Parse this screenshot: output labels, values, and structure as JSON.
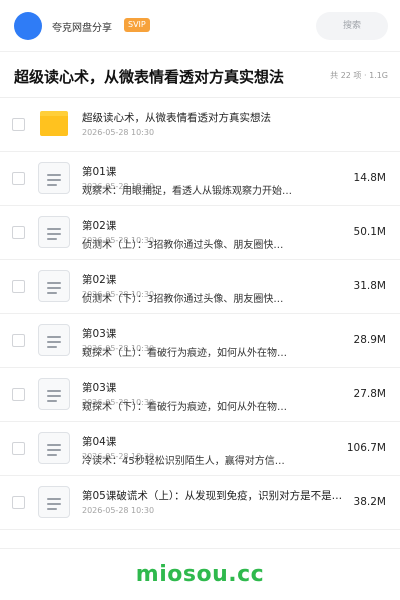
{
  "header": {
    "user_name": "夸克网盘分享",
    "badge": "SVIP",
    "search_placeholder": "搜索"
  },
  "share": {
    "title": "超级读心术，从微表情看透对方真实想法",
    "meta": "共 22 项 · 1.1G"
  },
  "folder": {
    "name": "超级读心术，从微表情看透对方真实想法",
    "date": "2026-05-28 10:30"
  },
  "files": [
    {
      "name": "第01课",
      "subtitle": "观察术：用眼捕捉，看透人从锻炼观察力开始…",
      "date": "2026-05-28 10:30",
      "size": "14.8M"
    },
    {
      "name": "第02课",
      "subtitle": "侦测术（上）：3招教你通过头像、朋友圈快…",
      "date": "2026-05-28 10:30",
      "size": "50.1M"
    },
    {
      "name": "第02课",
      "subtitle": "侦测术（下）：3招教你通过头像、朋友圈快…",
      "date": "2026-05-28 10:30",
      "size": "31.8M"
    },
    {
      "name": "第03课",
      "subtitle": "窥探术（上）：看破行为痕迹，如何从外在物…",
      "date": "2026-05-28 10:30",
      "size": "28.9M"
    },
    {
      "name": "第03课",
      "subtitle": "窥探术（下）：看破行为痕迹，如何从外在物…",
      "date": "2026-05-28 10:30",
      "size": "27.8M"
    },
    {
      "name": "第04课",
      "subtitle": "冷读术：45秒轻松识别陌生人，赢得对方信…",
      "date": "2026-05-28 10:30",
      "size": "106.7M"
    },
    {
      "name": "第05课破谎术（上）：从发现到免疫，识别对方是不是…",
      "subtitle": "",
      "date": "2026-05-28 10:30",
      "size": "38.2M"
    }
  ],
  "watermark": "miosou.cc"
}
